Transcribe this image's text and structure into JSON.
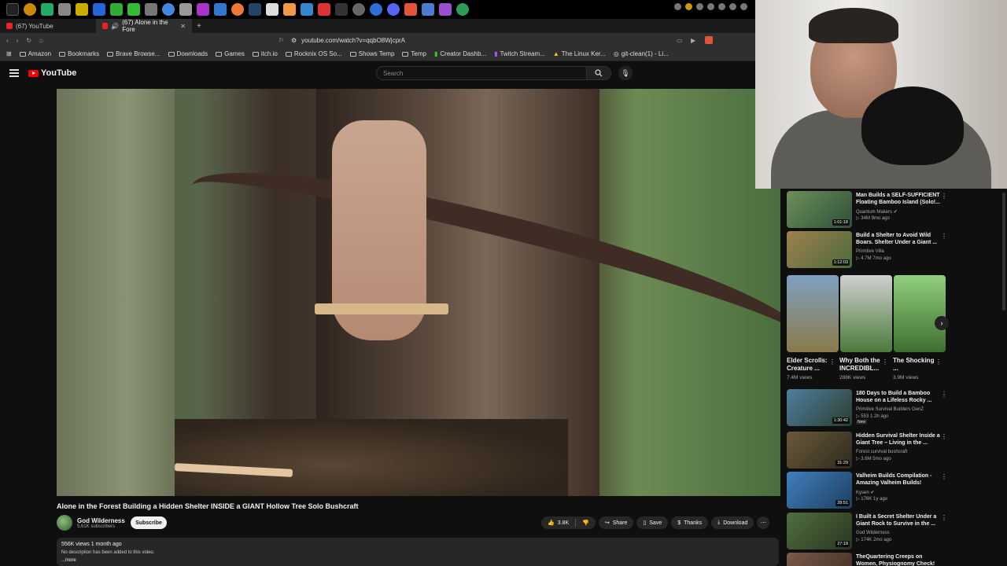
{
  "browser": {
    "tabs": [
      {
        "label": "(67) YouTube"
      },
      {
        "label": "(67) Alone in the Fore"
      }
    ],
    "url": "youtube.com/watch?v=qqbO8WjcprA",
    "bookmarks": [
      "Amazon",
      "Bookmarks",
      "Brave Browse...",
      "Downloads",
      "Games",
      "itch.io",
      "Rocknix OS So...",
      "Shows Temp",
      "Temp",
      "Creator Dashb...",
      "Twitch Stream...",
      "The Linux Ker...",
      "git-clean(1) - Li..."
    ]
  },
  "youtube": {
    "logo": "YouTube",
    "search_placeholder": "Search"
  },
  "video": {
    "title": "Alone in the Forest Building a Hidden Shelter INSIDE a GIANT Hollow Tree Solo Bushcraft",
    "channel": "God Wilderness",
    "subscribers": "5.61K subscribers",
    "subscribe_label": "Subscribe",
    "likes": "3.8K",
    "share_label": "Share",
    "save_label": "Save",
    "thanks_label": "Thanks",
    "download_label": "Download",
    "stats": "556K views  1 month ago",
    "description": "No description has been added to this video.",
    "more_label": "...more"
  },
  "recommendations": [
    {
      "title": "Man Builds a SELF-SUFFICIENT Floating Bamboo Island (Solo!...",
      "channel": "Quantum Makers",
      "meta": "34M  9mo ago",
      "duration": "1:01:18",
      "colors": [
        "#6c8f5a",
        "#2f4f3a"
      ]
    },
    {
      "title": "Build a Shelter to Avoid Wild Boars. Shelter Under a Giant ...",
      "channel": "Primitive Villa",
      "meta": "4.7M  7mo ago",
      "duration": "1:12:03",
      "colors": [
        "#a0804f",
        "#4a6b3a"
      ]
    },
    {
      "title": "180 Days to Build a Bamboo House on a Lifeless Rocky ...",
      "channel": "Primitive Survival Builders GenZ",
      "meta": "553  1.2h ago",
      "duration": "1:30:42",
      "new": "New",
      "colors": [
        "#4f7f9f",
        "#2b3d2f"
      ]
    },
    {
      "title": "Hidden Survival Shelter Inside a Giant Tree – Living in the ...",
      "channel": "Forest survival bushcraft",
      "meta": "3.6M  5mo ago",
      "duration": "31:29",
      "colors": [
        "#6b5a3a",
        "#2d2a1f"
      ]
    },
    {
      "title": "Valheim Builds Compilation - Amazing Valheim Builds!",
      "channel": "Kysen",
      "meta": "176K  1y ago",
      "duration": "28:51",
      "colors": [
        "#3f7fbf",
        "#1f3f5f"
      ]
    },
    {
      "title": "I Built a Secret Shelter Under a Giant Rock to Survive in the ...",
      "channel": "God Wilderness",
      "meta": "174K  2mo ago",
      "duration": "27:18",
      "colors": [
        "#4f6f3f",
        "#2a3520"
      ]
    },
    {
      "title": "TheQuartering Creeps on Women, Physiognomy Check!",
      "channel": "",
      "meta": "",
      "duration": "",
      "colors": [
        "#7a5a4a",
        "#3a2a22"
      ]
    }
  ],
  "shorts": [
    {
      "title": "Elder Scrolls: Creature ...",
      "views": "7.4M views",
      "colors": [
        "#7fa0c0",
        "#8a7a4a"
      ]
    },
    {
      "title": "Why Both the INCREDIBL...",
      "views": "288K views",
      "colors": [
        "#d0d0d0",
        "#4a7a3a"
      ]
    },
    {
      "title": "The Shocking ...",
      "views": "3.9M views",
      "colors": [
        "#8fcf7f",
        "#3f6f2f"
      ]
    }
  ]
}
